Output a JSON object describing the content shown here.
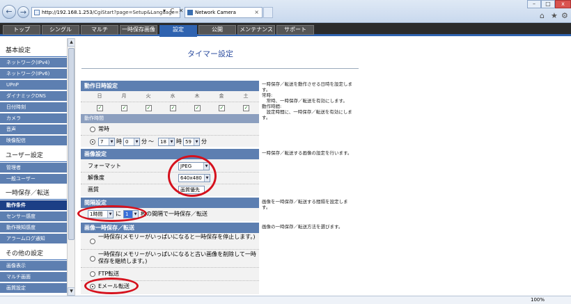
{
  "browser": {
    "address_host": "http://192.168.1.253",
    "address_path": "/CgiStart?page=Setup&Language=1",
    "address_controls": "▾ C ✕",
    "tab_title": "Network Camera",
    "tab_close": "×",
    "back": "←",
    "forward": "→",
    "win_min": "–",
    "win_max": "□",
    "win_close": "x",
    "home_icon": "⌂",
    "star_icon": "★",
    "gear_icon": "⚙",
    "zoom": "100%"
  },
  "topnav": [
    "トップ",
    "シングル",
    "マルチ",
    "一時保存画像",
    "設定",
    "公開",
    "メンテナンス",
    "サポート"
  ],
  "sidebar": {
    "basic": {
      "title": "基本設定",
      "items": [
        "ネットワーク(IPv4)",
        "ネットワーク(IPv6)",
        "UPnP",
        "ダイナミックDNS",
        "日付時刻",
        "カメラ",
        "音声",
        "映像配信"
      ]
    },
    "user": {
      "title": "ユーザー設定",
      "items": [
        "管理者",
        "一般ユーザー"
      ]
    },
    "save": {
      "title": "一時保存／転送",
      "items": [
        "動作条件",
        "センサー感度",
        "動作検知感度",
        "アラームログ通知"
      ]
    },
    "other": {
      "title": "その他の設定",
      "items": [
        "画像表示",
        "マルチ画面",
        "画質設定"
      ]
    }
  },
  "page_title": "タイマー設定",
  "schedule": {
    "title": "動作日時設定",
    "days": [
      "日",
      "月",
      "火",
      "水",
      "木",
      "金",
      "土"
    ],
    "check": "✓",
    "time_title": "動作時間",
    "always": "常時",
    "start_hour": "7",
    "hour_unit": "時",
    "start_min": "0",
    "min_unit": "分",
    "tilde": "～",
    "end_hour": "18",
    "end_min": "59",
    "note": "一時保存／転送を動作させる日時を設定します。\n常時:\n　常時、一時保存／転送を有効にします。\n動作時間:\n　設定時間に、一時保存／転送を有効にします。"
  },
  "image": {
    "title": "画像設定",
    "format_label": "フォーマット",
    "format": "JPEG",
    "resolution_label": "解像度",
    "resolution": "640x480",
    "quality_label": "画質",
    "quality": "画質優先",
    "note": "一時保存／転送する画像の設定を行います。"
  },
  "interval": {
    "title": "間隔設定",
    "period": "1時間",
    "ni": "に",
    "count": "1",
    "suffix": "枚の間隔で一時保存／転送",
    "note": "画像を一時保存／転送する間隔を設定します。"
  },
  "method": {
    "title": "画像一時保存／転送",
    "opt1": "一時保存(メモリーがいっぱいになると一時保存を停止します。)",
    "opt2": "一時保存(メモリーがいっぱいになると古い画像を削除して一時保存を継続します。)",
    "opt3": "FTP転送",
    "opt4": "Eメール転送",
    "note": "画像の一時保存／転送方法を選びます。"
  },
  "arrow_down": "▼",
  "arrow_up": "▲"
}
